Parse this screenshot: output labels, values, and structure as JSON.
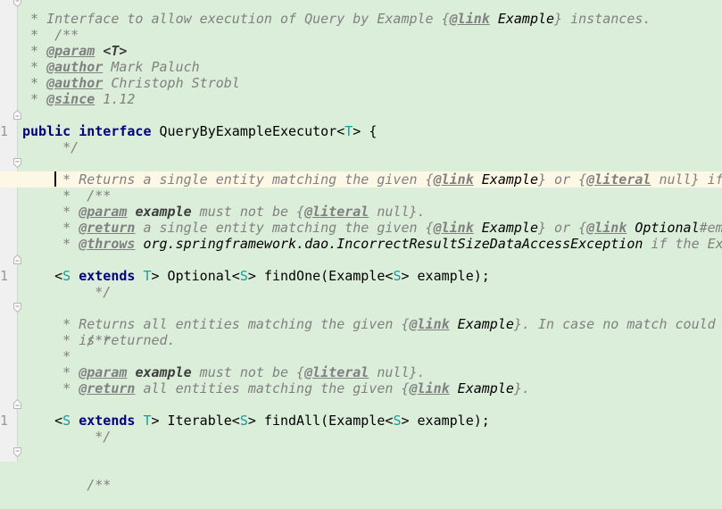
{
  "editor": {
    "language": "Java",
    "gutter": {
      "visible_line_number_fragment": "1"
    },
    "colors": {
      "background": "#dbeed9",
      "current_line": "#fdf8e6",
      "comment": "#808080",
      "keyword": "#000080",
      "type_parameter": "#20999d",
      "gutter": "#f0f0f0"
    },
    "lines": {
      "l0": {
        "open": "/**"
      },
      "l1": {
        "star": " * ",
        "text": "Interface to allow execution of Query by Example {",
        "tag": "@link",
        "ref": " Example",
        "tail": "} instances."
      },
      "l2": {
        "star": " *"
      },
      "l3": {
        "star": " * ",
        "tag": "@param",
        "sp": " ",
        "param": "<T>"
      },
      "l4": {
        "star": " * ",
        "tag": "@author",
        "text": " Mark Paluch"
      },
      "l5": {
        "star": " * ",
        "tag": "@author",
        "text": " Christoph Strobl"
      },
      "l6": {
        "star": " * ",
        "tag": "@since",
        "text": " 1.12"
      },
      "l7": {
        "close": " */"
      },
      "l8": {
        "kw1": "public",
        "sp1": " ",
        "kw2": "interface",
        "name": " QueryByExampleExecutor<",
        "tp": "T",
        "rest": "> {"
      },
      "l9": {},
      "l10": {
        "indent": "    ",
        "open": "/**"
      },
      "l11": {
        "indent": "    ",
        "star": " * ",
        "text": "Returns a single entity matching the given {",
        "tag": "@link",
        "ref": " Example",
        "mid": "} or {",
        "tag2": "@literal",
        "tail": " null} if"
      },
      "l12": {
        "indent": "    ",
        "star": " *"
      },
      "l13": {
        "indent": "    ",
        "star": " * ",
        "tag": "@param",
        "sp": " ",
        "param": "example",
        "text": " must not be {",
        "tag2": "@literal",
        "tail": " null}."
      },
      "l14": {
        "indent": "    ",
        "star": " * ",
        "tag": "@return",
        "text": " a single entity matching the given {",
        "tag2": "@link",
        "ref": " Example",
        "mid": "} or {",
        "tag3": "@link",
        "ref2": " Optional",
        "tail": "#emp"
      },
      "l15": {
        "indent": "    ",
        "star": " * ",
        "tag": "@throws",
        "ref": " org.springframework.dao.IncorrectResultSizeDataAccessException",
        "tail": " if the Ex"
      },
      "l16": {
        "indent": "    ",
        "close": " */"
      },
      "l17": {
        "indent": "    ",
        "lt": "<",
        "tp1": "S",
        "sp": " ",
        "kw": "extends",
        "sp2": " ",
        "tp2": "T",
        "a": "> Optional<",
        "tp3": "S",
        "b": "> findOne(Example<",
        "tp4": "S",
        "c": "> example);"
      },
      "l18": {},
      "l19": {
        "indent": "    ",
        "open": "/**"
      },
      "l20": {
        "indent": "    ",
        "star": " * ",
        "text": "Returns all entities matching the given {",
        "tag": "@link",
        "ref": " Example",
        "tail": "}. In case no match could "
      },
      "l21": {
        "indent": "    ",
        "star": " * ",
        "text": "is returned."
      },
      "l22": {
        "indent": "    ",
        "star": " *"
      },
      "l23": {
        "indent": "    ",
        "star": " * ",
        "tag": "@param",
        "sp": " ",
        "param": "example",
        "text": " must not be {",
        "tag2": "@literal",
        "tail": " null}."
      },
      "l24": {
        "indent": "    ",
        "star": " * ",
        "tag": "@return",
        "text": " all entities matching the given {",
        "tag2": "@link",
        "ref": " Example",
        "tail": "}."
      },
      "l25": {
        "indent": "    ",
        "close": " */"
      },
      "l26": {
        "indent": "    ",
        "lt": "<",
        "tp1": "S",
        "sp": " ",
        "kw": "extends",
        "sp2": " ",
        "tp2": "T",
        "a": "> Iterable<",
        "tp3": "S",
        "b": "> findAll(Example<",
        "tp4": "S",
        "c": "> example);"
      },
      "l27": {},
      "l28": {
        "indent": "    ",
        "open": "/**"
      }
    }
  }
}
